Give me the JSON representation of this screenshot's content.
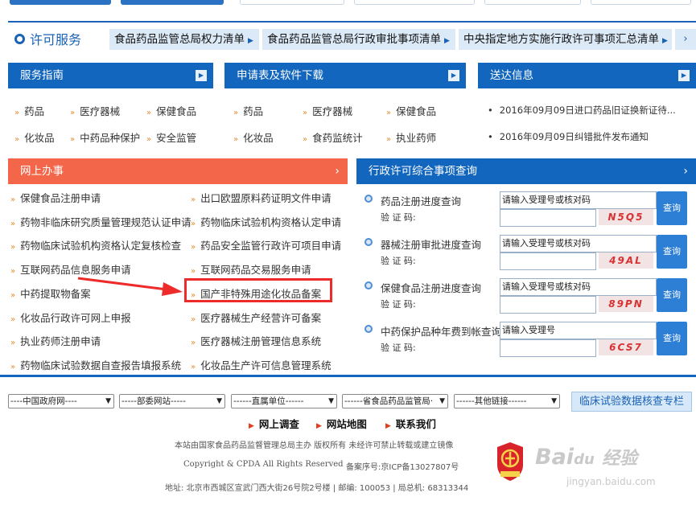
{
  "xuke": {
    "title": "许可服务",
    "links": [
      "食品药品监管总局权力清单",
      "食品药品监管总局行政审批事项清单",
      "中央指定地方实施行政许可事项汇总清单"
    ]
  },
  "panels": {
    "guide": {
      "title": "服务指南",
      "row1": [
        "药品",
        "医疗器械",
        "保健食品"
      ],
      "row2": [
        "化妆品",
        "中药品种保护",
        "安全监管"
      ]
    },
    "download": {
      "title": "申请表及软件下载",
      "row1": [
        "药品",
        "医疗器械",
        "保健食品"
      ],
      "row2": [
        "化妆品",
        "食药监统计",
        "执业药师"
      ]
    },
    "delivery": {
      "title": "送达信息",
      "items": [
        "2016年09月09日进口药品旧证换新证待...",
        "2016年09月09日纠错批件发布通知"
      ]
    }
  },
  "online": {
    "title": "网上办事",
    "left": [
      "保健食品注册申请",
      "药物非临床研究质量管理规范认证申请",
      "药物临床试验机构资格认定复核检查",
      "互联网药品信息服务申请",
      "中药提取物备案",
      "化妆品行政许可网上申报",
      "执业药师注册申请",
      "药物临床试验数据自查报告填报系统"
    ],
    "right": [
      "出口欧盟原料药证明文件申请",
      "药物临床试验机构资格认定申请",
      "药品安全监管行政许可项目申请",
      "互联网药品交易服务申请",
      "国产非特殊用途化妆品备案",
      "医疗器械生产经营许可备案",
      "医疗器械注册管理信息系统",
      "化妆品生产许可信息管理系统"
    ]
  },
  "query": {
    "title": "行政许可综合事项查询",
    "captcha_label": "验 证 码:",
    "button": "查询",
    "items": [
      {
        "label": "药品注册进度查询",
        "placeholder": "请输入受理号或核对码",
        "code": "N5Q5"
      },
      {
        "label": "器械注册审批进度查询",
        "placeholder": "请输入受理号或核对码",
        "code": "49AL"
      },
      {
        "label": "保健食品注册进度查询",
        "placeholder": "请输入受理号或核对码",
        "code": "89PN"
      },
      {
        "label": "中药保护品种年费到帐查询",
        "placeholder": "请输入受理号",
        "code": "6CS7"
      }
    ]
  },
  "footer": {
    "selects": [
      "----中国政府网----",
      "-----部委网站-----",
      "------直属单位------",
      "------省食品药品监管局·",
      "------其他链接------"
    ],
    "clinical_button": "临床试验数据核查专栏",
    "links": [
      "网上调查",
      "网站地图",
      "联系我们"
    ],
    "line1": "本站由国家食品药品监督管理总局主办 版权所有 未经许可禁止转载或建立镜像",
    "copyright": "Copyright & CPDA All Rights Reserved",
    "icp": "备案序号:京ICP备13027807号",
    "address": "地址: 北京市西城区宣武门西大街26号院2号楼  |  邮编: 100053  |  局总机: 68313344"
  },
  "watermark": {
    "brand": "Bai",
    "brand2": "经验",
    "sub": "jingyan.baidu.com"
  },
  "colors": {
    "primary": "#1266be",
    "orange": "#f4664a",
    "highlight": "#ee2b2b"
  }
}
